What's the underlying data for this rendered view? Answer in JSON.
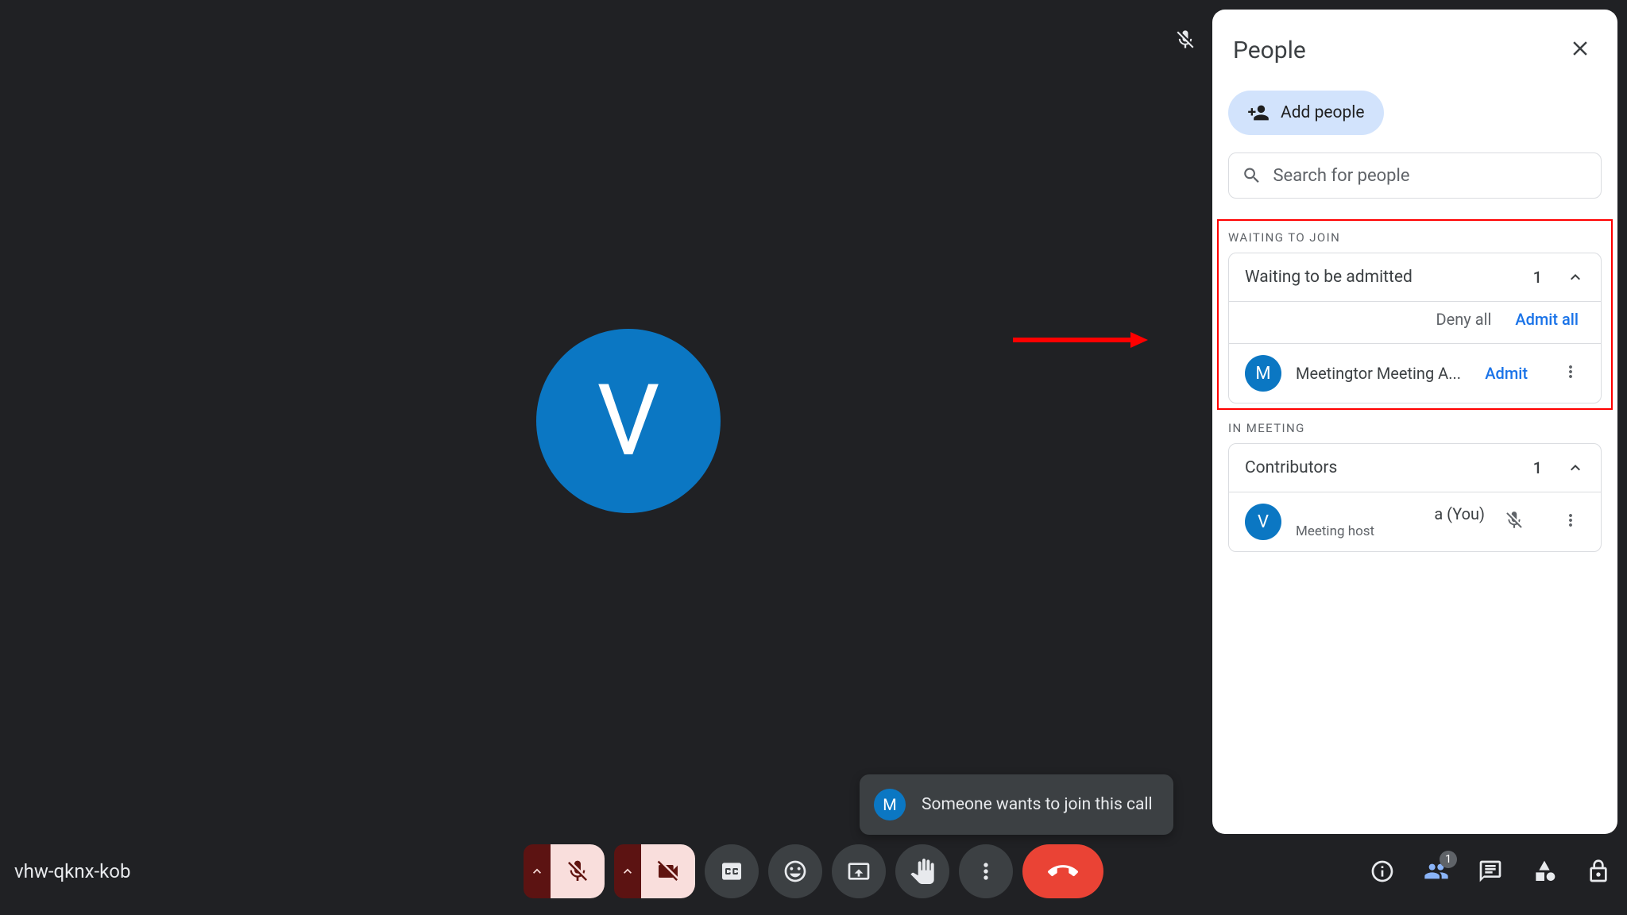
{
  "meeting_code": "vhw-qknx-kob",
  "main_avatar_initial": "V",
  "toast": {
    "avatar_initial": "M",
    "text": "Someone wants to join this call"
  },
  "panel": {
    "title": "People",
    "add_people_label": "Add people",
    "search_placeholder": "Search for people",
    "waiting_section_label": "WAITING TO JOIN",
    "waiting_card": {
      "title": "Waiting to be admitted",
      "count": "1",
      "deny_all": "Deny all",
      "admit_all": "Admit all",
      "person": {
        "initial": "M",
        "name": "Meetingtor Meeting A...",
        "admit": "Admit"
      }
    },
    "in_meeting_label": "IN MEETING",
    "contributors_card": {
      "title": "Contributors",
      "count": "1",
      "person": {
        "initial": "V",
        "name_suffix": "a (You)",
        "role": "Meeting host"
      }
    }
  },
  "people_badge_count": "1"
}
